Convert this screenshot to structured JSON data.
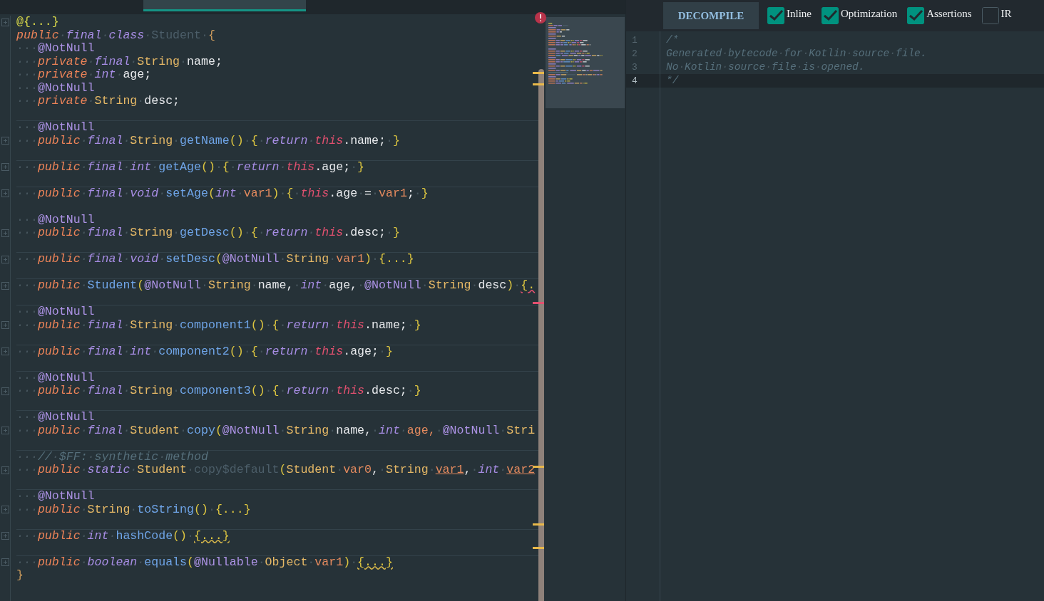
{
  "editor_tabs": [
    {
      "selected": true
    }
  ],
  "code": {
    "blocks": [
      {
        "lines": [
          {
            "fold": true,
            "tokens": [
              {
                "kind": "at",
                "text": "@{...}"
              }
            ]
          },
          {
            "fold": false,
            "tokens": [
              {
                "kind": "mod",
                "text": "public·"
              },
              {
                "kind": "kw",
                "text": "final·"
              },
              {
                "kind": "kw",
                "text": "class·"
              },
              {
                "kind": "unused",
                "text": "Student·"
              },
              {
                "kind": "brace",
                "text": "{"
              }
            ]
          },
          {
            "fold": false,
            "tokens": [
              {
                "kind": "ann",
                "text": "···@NotNull"
              }
            ]
          },
          {
            "fold": false,
            "tokens": [
              {
                "kind": "mod",
                "text": "···private·"
              },
              {
                "kind": "kw",
                "text": "final·"
              },
              {
                "kind": "type",
                "text": "String·"
              },
              {
                "kind": "text",
                "text": "name;"
              }
            ]
          },
          {
            "fold": false,
            "tokens": [
              {
                "kind": "mod",
                "text": "···private·"
              },
              {
                "kind": "kw",
                "text": "int·"
              },
              {
                "kind": "text",
                "text": "age;"
              }
            ]
          },
          {
            "fold": false,
            "tokens": [
              {
                "kind": "ann",
                "text": "···@NotNull"
              }
            ]
          },
          {
            "fold": false,
            "tokens": [
              {
                "kind": "mod",
                "text": "···private·"
              },
              {
                "kind": "type",
                "text": "String·"
              },
              {
                "kind": "text",
                "text": "desc;"
              }
            ]
          }
        ]
      },
      {
        "lines": [
          {
            "fold": false,
            "tokens": [
              {
                "kind": "ann",
                "text": "···@NotNull"
              }
            ]
          },
          {
            "fold": true,
            "tokens": [
              {
                "kind": "mod",
                "text": "···public·"
              },
              {
                "kind": "kw",
                "text": "final·"
              },
              {
                "kind": "type",
                "text": "String·"
              },
              {
                "kind": "fn",
                "text": "getName"
              },
              {
                "kind": "punc",
                "text": "()·"
              },
              {
                "kind": "punc",
                "text": "{·"
              },
              {
                "kind": "kw",
                "text": "return·"
              },
              {
                "kind": "this",
                "text": "this"
              },
              {
                "kind": "text",
                "text": ".name;·"
              },
              {
                "kind": "punc",
                "text": "}"
              }
            ]
          }
        ]
      },
      {
        "lines": [
          {
            "fold": true,
            "tokens": [
              {
                "kind": "mod",
                "text": "···public·"
              },
              {
                "kind": "kw",
                "text": "final·"
              },
              {
                "kind": "kw",
                "text": "int·"
              },
              {
                "kind": "fn",
                "text": "getAge"
              },
              {
                "kind": "punc",
                "text": "()·"
              },
              {
                "kind": "punc",
                "text": "{·"
              },
              {
                "kind": "kw",
                "text": "return·"
              },
              {
                "kind": "this",
                "text": "this"
              },
              {
                "kind": "text",
                "text": ".age;·"
              },
              {
                "kind": "punc",
                "text": "}"
              }
            ]
          }
        ]
      },
      {
        "lines": [
          {
            "fold": true,
            "tokens": [
              {
                "kind": "mod",
                "text": "···public·"
              },
              {
                "kind": "kw",
                "text": "final·"
              },
              {
                "kind": "kw",
                "text": "void·"
              },
              {
                "kind": "fn",
                "text": "setAge"
              },
              {
                "kind": "punc",
                "text": "("
              },
              {
                "kind": "kw",
                "text": "int·"
              },
              {
                "kind": "param",
                "text": "var1"
              },
              {
                "kind": "punc",
                "text": ")·"
              },
              {
                "kind": "punc",
                "text": "{·"
              },
              {
                "kind": "this",
                "text": "this"
              },
              {
                "kind": "text",
                "text": ".age·=·"
              },
              {
                "kind": "param",
                "text": "var1"
              },
              {
                "kind": "text",
                "text": ";·"
              },
              {
                "kind": "punc",
                "text": "}"
              }
            ]
          },
          {
            "fold": false
          },
          {
            "fold": false,
            "tokens": [
              {
                "kind": "ann",
                "text": "···@NotNull"
              }
            ]
          },
          {
            "fold": true,
            "tokens": [
              {
                "kind": "mod",
                "text": "···public·"
              },
              {
                "kind": "kw",
                "text": "final·"
              },
              {
                "kind": "type",
                "text": "String·"
              },
              {
                "kind": "fn",
                "text": "getDesc"
              },
              {
                "kind": "punc",
                "text": "()·"
              },
              {
                "kind": "punc",
                "text": "{·"
              },
              {
                "kind": "kw",
                "text": "return·"
              },
              {
                "kind": "this",
                "text": "this"
              },
              {
                "kind": "text",
                "text": ".desc;·"
              },
              {
                "kind": "punc",
                "text": "}"
              }
            ]
          }
        ]
      },
      {
        "lines": [
          {
            "fold": true,
            "tokens": [
              {
                "kind": "mod",
                "text": "···public·"
              },
              {
                "kind": "kw",
                "text": "final·"
              },
              {
                "kind": "kw",
                "text": "void·"
              },
              {
                "kind": "fn",
                "text": "setDesc"
              },
              {
                "kind": "punc",
                "text": "("
              },
              {
                "kind": "ann",
                "text": "@NotNull·"
              },
              {
                "kind": "type",
                "text": "String·"
              },
              {
                "kind": "param",
                "text": "var1"
              },
              {
                "kind": "punc",
                "text": ")·"
              },
              {
                "kind": "punc",
                "text": "{...}"
              }
            ]
          }
        ]
      },
      {
        "lines": [
          {
            "fold": true,
            "tokens": [
              {
                "kind": "mod",
                "text": "···public·"
              },
              {
                "kind": "fn",
                "text": "Student"
              },
              {
                "kind": "punc",
                "text": "("
              },
              {
                "kind": "ann",
                "text": "@NotNull·"
              },
              {
                "kind": "type",
                "text": "String·"
              },
              {
                "kind": "text",
                "text": "name,·"
              },
              {
                "kind": "kw",
                "text": "int·"
              },
              {
                "kind": "text",
                "text": "age,·"
              },
              {
                "kind": "ann",
                "text": "@NotNull·"
              },
              {
                "kind": "type",
                "text": "String·"
              },
              {
                "kind": "text",
                "text": "desc"
              },
              {
                "kind": "punc",
                "text": ")·"
              },
              {
                "kind": "punc",
                "text": "{.",
                "error": true
              }
            ]
          }
        ]
      },
      {
        "lines": [
          {
            "fold": false,
            "tokens": [
              {
                "kind": "ann",
                "text": "···@NotNull"
              }
            ]
          },
          {
            "fold": true,
            "tokens": [
              {
                "kind": "mod",
                "text": "···public·"
              },
              {
                "kind": "kw",
                "text": "final·"
              },
              {
                "kind": "type",
                "text": "String·"
              },
              {
                "kind": "fn",
                "text": "component1"
              },
              {
                "kind": "punc",
                "text": "()·"
              },
              {
                "kind": "punc",
                "text": "{·"
              },
              {
                "kind": "kw",
                "text": "return·"
              },
              {
                "kind": "this",
                "text": "this"
              },
              {
                "kind": "text",
                "text": ".name;·"
              },
              {
                "kind": "punc",
                "text": "}"
              }
            ]
          }
        ]
      },
      {
        "lines": [
          {
            "fold": true,
            "tokens": [
              {
                "kind": "mod",
                "text": "···public·"
              },
              {
                "kind": "kw",
                "text": "final·"
              },
              {
                "kind": "kw",
                "text": "int·"
              },
              {
                "kind": "fn",
                "text": "component2"
              },
              {
                "kind": "punc",
                "text": "()·"
              },
              {
                "kind": "punc",
                "text": "{·"
              },
              {
                "kind": "kw",
                "text": "return·"
              },
              {
                "kind": "this",
                "text": "this"
              },
              {
                "kind": "text",
                "text": ".age;·"
              },
              {
                "kind": "punc",
                "text": "}"
              }
            ]
          }
        ]
      },
      {
        "lines": [
          {
            "fold": false,
            "tokens": [
              {
                "kind": "ann",
                "text": "···@NotNull"
              }
            ]
          },
          {
            "fold": true,
            "tokens": [
              {
                "kind": "mod",
                "text": "···public·"
              },
              {
                "kind": "kw",
                "text": "final·"
              },
              {
                "kind": "type",
                "text": "String·"
              },
              {
                "kind": "fn",
                "text": "component3"
              },
              {
                "kind": "punc",
                "text": "()·"
              },
              {
                "kind": "punc",
                "text": "{·"
              },
              {
                "kind": "kw",
                "text": "return·"
              },
              {
                "kind": "this",
                "text": "this"
              },
              {
                "kind": "text",
                "text": ".desc;·"
              },
              {
                "kind": "punc",
                "text": "}"
              }
            ]
          }
        ]
      },
      {
        "lines": [
          {
            "fold": false,
            "tokens": [
              {
                "kind": "ann",
                "text": "···@NotNull"
              }
            ]
          },
          {
            "fold": true,
            "tokens": [
              {
                "kind": "mod",
                "text": "···public·"
              },
              {
                "kind": "kw",
                "text": "final·"
              },
              {
                "kind": "type",
                "text": "Student·"
              },
              {
                "kind": "fn",
                "text": "copy"
              },
              {
                "kind": "punc",
                "text": "("
              },
              {
                "kind": "ann",
                "text": "@NotNull·"
              },
              {
                "kind": "type",
                "text": "String·"
              },
              {
                "kind": "text",
                "text": "name,·"
              },
              {
                "kind": "kw",
                "text": "int·"
              },
              {
                "kind": "param",
                "text": "age,·"
              },
              {
                "kind": "ann",
                "text": "@NotNull·"
              },
              {
                "kind": "type",
                "text": "Stri"
              }
            ]
          }
        ]
      },
      {
        "lines": [
          {
            "fold": false,
            "tokens": [
              {
                "kind": "comment",
                "text": "···//·$FF:·synthetic·method"
              }
            ]
          },
          {
            "fold": true,
            "tokens": [
              {
                "kind": "mod",
                "text": "···public·"
              },
              {
                "kind": "kw",
                "text": "static·"
              },
              {
                "kind": "type",
                "text": "Student·"
              },
              {
                "kind": "unused",
                "text": "copy$default"
              },
              {
                "kind": "punc",
                "text": "("
              },
              {
                "kind": "type",
                "text": "Student·"
              },
              {
                "kind": "param",
                "text": "var0"
              },
              {
                "kind": "text",
                "text": ",·"
              },
              {
                "kind": "type",
                "text": "String·"
              },
              {
                "kind": "param",
                "text": "var1",
                "unused": true
              },
              {
                "kind": "text",
                "text": ",·"
              },
              {
                "kind": "kw",
                "text": "int·"
              },
              {
                "kind": "param",
                "text": "var2",
                "unused": true
              }
            ]
          }
        ]
      },
      {
        "lines": [
          {
            "fold": false,
            "tokens": [
              {
                "kind": "ann",
                "text": "···@NotNull"
              }
            ]
          },
          {
            "fold": true,
            "tokens": [
              {
                "kind": "mod",
                "text": "···public·"
              },
              {
                "kind": "type",
                "text": "String·"
              },
              {
                "kind": "fn",
                "text": "toString"
              },
              {
                "kind": "punc",
                "text": "()·"
              },
              {
                "kind": "punc",
                "text": "{...}"
              }
            ]
          }
        ]
      },
      {
        "lines": [
          {
            "fold": true,
            "tokens": [
              {
                "kind": "mod",
                "text": "···public·"
              },
              {
                "kind": "kw",
                "text": "int·"
              },
              {
                "kind": "fn",
                "text": "hashCode"
              },
              {
                "kind": "punc",
                "text": "()·"
              },
              {
                "kind": "punc",
                "text": "{...}",
                "warning": true
              }
            ]
          }
        ]
      },
      {
        "lines": [
          {
            "fold": true,
            "tokens": [
              {
                "kind": "mod",
                "text": "···public·"
              },
              {
                "kind": "kw",
                "text": "boolean·"
              },
              {
                "kind": "fn",
                "text": "equals"
              },
              {
                "kind": "punc",
                "text": "("
              },
              {
                "kind": "ann",
                "text": "@Nullable·"
              },
              {
                "kind": "type",
                "text": "Object·"
              },
              {
                "kind": "param",
                "text": "var1"
              },
              {
                "kind": "punc",
                "text": ")·"
              },
              {
                "kind": "punc",
                "text": "{...}",
                "warning": true
              }
            ]
          },
          {
            "fold": false,
            "tokens": [
              {
                "kind": "brace",
                "text": "}"
              }
            ]
          }
        ]
      }
    ]
  },
  "decompiler": {
    "button": "DECOMPILE",
    "options": [
      {
        "label": "Inline",
        "checked": true
      },
      {
        "label": "Optimization",
        "checked": true
      },
      {
        "label": "Assertions",
        "checked": true
      },
      {
        "label": "IR",
        "checked": false
      }
    ],
    "lines": [
      {
        "number": "1",
        "text": "/*",
        "current": false
      },
      {
        "number": "2",
        "text": "Generated·bytecode·for·Kotlin·source·file.",
        "current": false
      },
      {
        "number": "3",
        "text": "No·Kotlin·source·file·is·opened.",
        "current": false
      },
      {
        "number": "4",
        "text": "*/",
        "current": true
      }
    ]
  }
}
